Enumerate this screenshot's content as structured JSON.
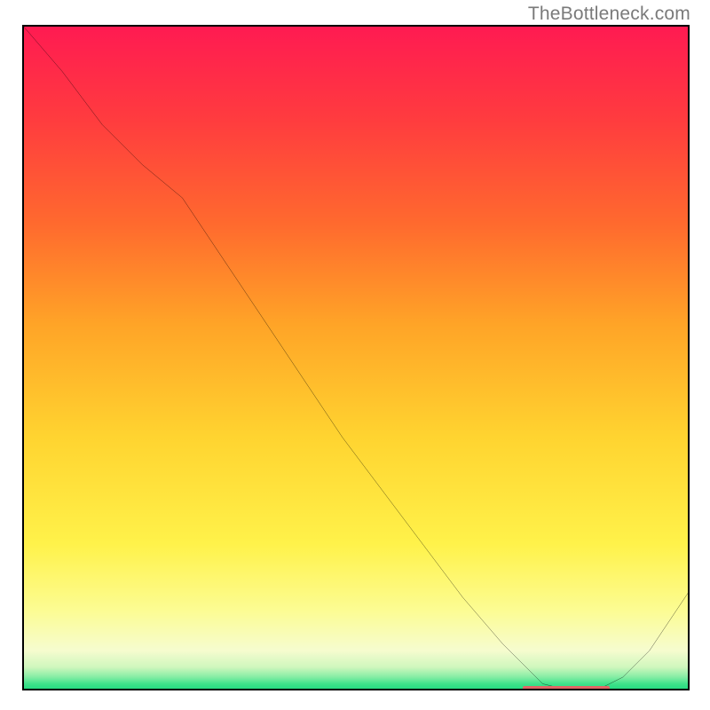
{
  "watermark": "TheBottleneck.com",
  "chart_data": {
    "type": "line",
    "title": "",
    "xlabel": "",
    "ylabel": "",
    "xlim": [
      0,
      100
    ],
    "ylim": [
      0,
      100
    ],
    "series": [
      {
        "name": "curve",
        "x": [
          0,
          6,
          12,
          18,
          24,
          30,
          36,
          42,
          48,
          54,
          60,
          66,
          72,
          78,
          82,
          86,
          90,
          94,
          100
        ],
        "y": [
          100,
          93,
          85,
          79,
          74,
          65,
          56,
          47,
          38,
          30,
          22,
          14,
          7,
          1,
          0,
          0,
          2,
          6,
          15
        ]
      }
    ],
    "marker": {
      "x_start": 75,
      "x_end": 88,
      "y": 0.3
    },
    "gradient_stops": [
      {
        "pos": 0.0,
        "color": "#ff1a52"
      },
      {
        "pos": 0.3,
        "color": "#ff6a2e"
      },
      {
        "pos": 0.62,
        "color": "#ffd430"
      },
      {
        "pos": 0.88,
        "color": "#fcfc93"
      },
      {
        "pos": 0.98,
        "color": "#84eda4"
      },
      {
        "pos": 1.0,
        "color": "#1fd97f"
      }
    ]
  }
}
